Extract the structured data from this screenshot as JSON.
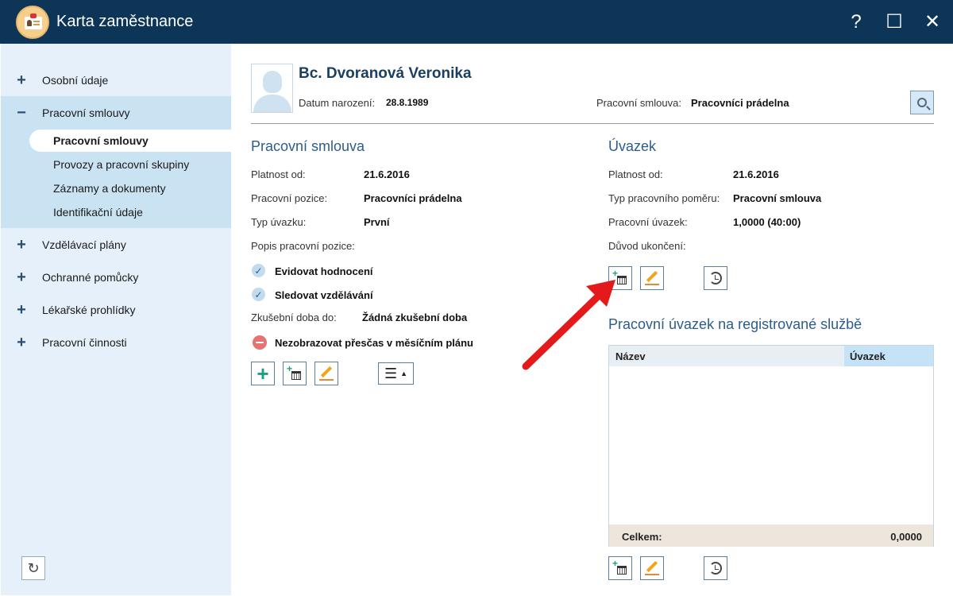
{
  "window": {
    "title": "Karta zaměstnance",
    "help_glyph": "?",
    "maximize_glyph": "☐",
    "close_glyph": "✕"
  },
  "sidebar": {
    "items": [
      {
        "sign": "+",
        "label": "Osobní údaje"
      },
      {
        "sign": "−",
        "label": "Pracovní smlouvy"
      },
      {
        "sign": "+",
        "label": "Vzdělávací plány"
      },
      {
        "sign": "+",
        "label": "Ochranné pomůcky"
      },
      {
        "sign": "+",
        "label": "Lékařské prohlídky"
      },
      {
        "sign": "+",
        "label": "Pracovní činnosti"
      }
    ],
    "subitems": [
      {
        "label": "Pracovní smlouvy",
        "active": true
      },
      {
        "label": "Provozy a pracovní skupiny"
      },
      {
        "label": "Záznamy a dokumenty"
      },
      {
        "label": "Identifikační údaje"
      }
    ],
    "refresh_icon": "refresh-icon",
    "refresh_glyph": "↻"
  },
  "employee": {
    "name": "Bc. Dvoranová Veronika",
    "birth_label": "Datum narození:",
    "birth_value": "28.8.1989",
    "contract_label": "Pracovní smlouva:",
    "contract_value": "Pracovníci prádelna"
  },
  "contract": {
    "title": "Pracovní smlouva",
    "fields": [
      {
        "label": "Platnost od:",
        "value": "21.6.2016"
      },
      {
        "label": "Pracovní pozice:",
        "value": "Pracovníci prádelna"
      },
      {
        "label": "Typ úvazku:",
        "value": "První"
      },
      {
        "label": "Popis pracovní pozice:",
        "value": ""
      }
    ],
    "flags": [
      {
        "label": "Evidovat hodnocení",
        "state": "checked"
      },
      {
        "label": "Sledovat vzdělávání",
        "state": "checked"
      }
    ],
    "probation_label": "Zkušební doba do:",
    "probation_value": "Žádná zkušební doba",
    "overtime_label": "Nezobrazovat přesčas v měsíčním plánu",
    "check_glyph": "✓",
    "plus_glyph": "+",
    "menu_glyph": "☰",
    "menu_caret": "▲"
  },
  "workload": {
    "title": "Úvazek",
    "fields": [
      {
        "label": "Platnost od:",
        "value": "21.6.2016"
      },
      {
        "label": "Typ pracovního poměru:",
        "value": "Pracovní smlouva"
      },
      {
        "label": "Pracovní úvazek:",
        "value": "1,0000 (40:00)"
      },
      {
        "label": "Důvod ukončení:",
        "value": ""
      }
    ]
  },
  "registered": {
    "title": "Pracovní úvazek na registrované službě",
    "columns": [
      "Název",
      "Úvazek"
    ],
    "rows": [],
    "total_label": "Celkem:",
    "total_value": "0,0000"
  },
  "colors": {
    "titlebar": "#0d3558",
    "sidebar": "#e5f0fa",
    "sidebar_group": "#c9e3f3",
    "accent": "#2e5c8a",
    "arrow": "#e3191c"
  }
}
